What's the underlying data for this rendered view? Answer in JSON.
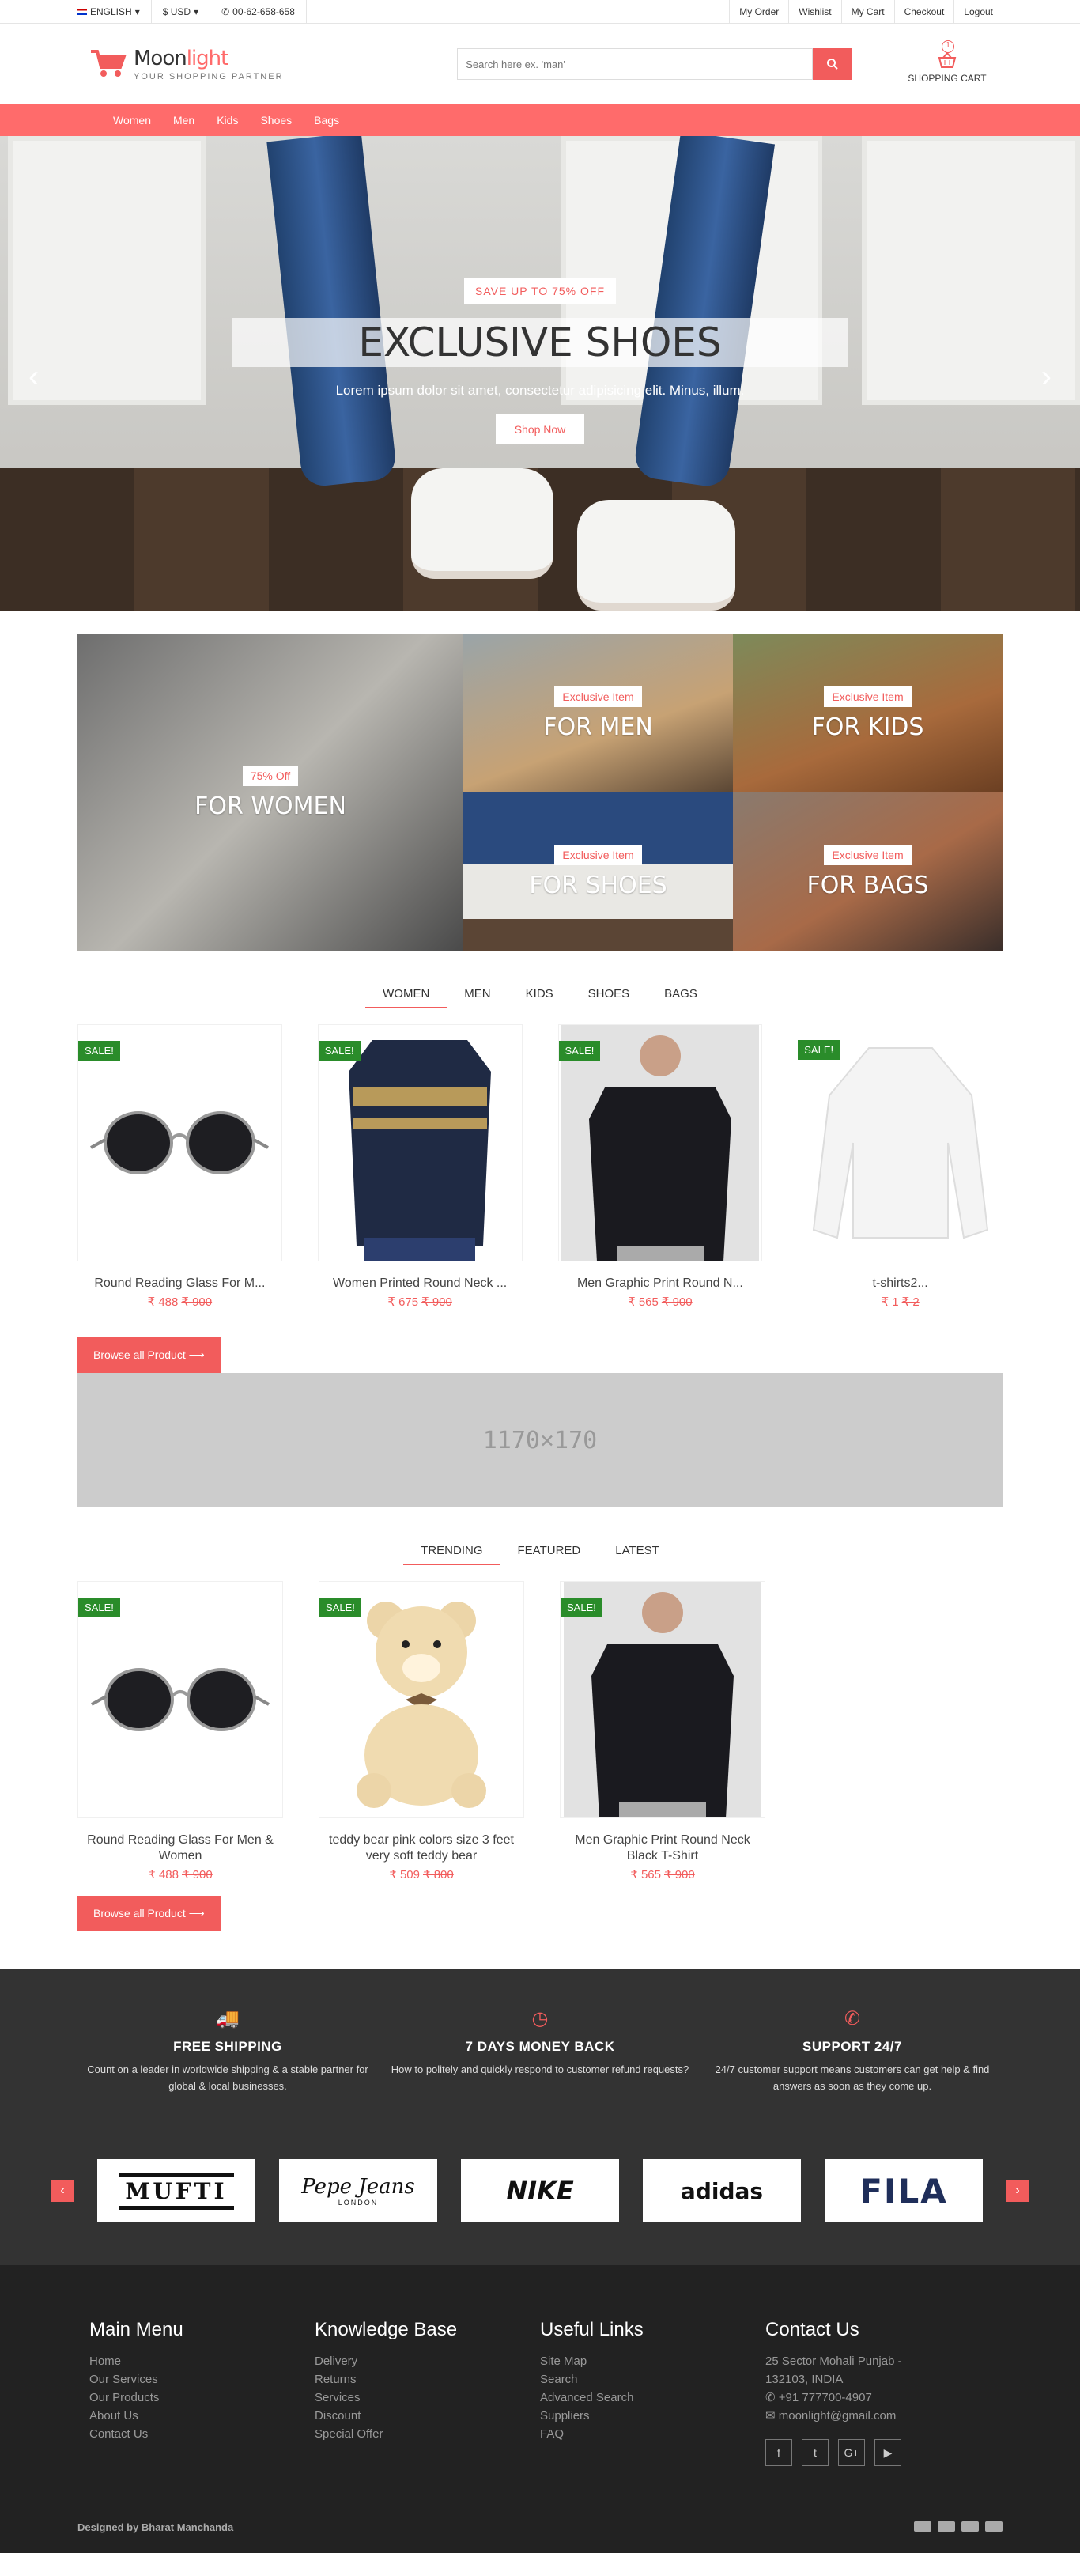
{
  "topbar": {
    "language": "ENGLISH",
    "currency": "$ USD",
    "phone": "00-62-658-658",
    "links": [
      "My Order",
      "Wishlist",
      "My Cart",
      "Checkout",
      "Logout"
    ]
  },
  "header": {
    "logo_main": "Moon",
    "logo_accent": "light",
    "tagline": "YOUR SHOPPING PARTNER",
    "search_placeholder": "Search here ex. 'man'",
    "cart_count": "1",
    "cart_label": "SHOPPING CART"
  },
  "nav": [
    "Women",
    "Men",
    "Kids",
    "Shoes",
    "Bags"
  ],
  "hero": {
    "badge": "SAVE UP TO 75% OFF",
    "title": "EXCLUSIVE SHOES",
    "subtitle": "Lorem ipsum dolor sit amet, consectetur adipisicing elit. Minus, illum.",
    "button": "Shop Now"
  },
  "categories": [
    {
      "badge": "75% Off",
      "label": "FOR WOMEN"
    },
    {
      "badge": "Exclusive Item",
      "label": "FOR MEN"
    },
    {
      "badge": "Exclusive Item",
      "label": "FOR KIDS"
    },
    {
      "badge": "Exclusive Item",
      "label": "FOR SHOES"
    },
    {
      "badge": "Exclusive Item",
      "label": "FOR BAGS"
    }
  ],
  "tabs1": [
    "WOMEN",
    "MEN",
    "KIDS",
    "SHOES",
    "BAGS"
  ],
  "products1": [
    {
      "sale": "SALE!",
      "name": "Round Reading Glass For M...",
      "price": "₹ 488",
      "old": "₹ 900"
    },
    {
      "sale": "SALE!",
      "name": "Women Printed Round Neck ...",
      "price": "₹ 675",
      "old": "₹ 900"
    },
    {
      "sale": "SALE!",
      "name": "Men Graphic Print Round N...",
      "price": "₹ 565",
      "old": "₹ 900"
    },
    {
      "sale": "SALE!",
      "name": "t-shirts2...",
      "price": "₹ 1",
      "old": "₹ 2"
    }
  ],
  "browse": "Browse all Product",
  "banner": "1170×170",
  "tabs2": [
    "TRENDING",
    "FEATURED",
    "LATEST"
  ],
  "products2": [
    {
      "sale": "SALE!",
      "name": "Round Reading Glass For Men & Women",
      "price": "₹ 488",
      "old": "₹ 900"
    },
    {
      "sale": "SALE!",
      "name": "teddy bear pink colors size 3 feet very soft teddy bear",
      "price": "₹ 509",
      "old": "₹ 800"
    },
    {
      "sale": "SALE!",
      "name": "Men Graphic Print Round Neck Black T-Shirt",
      "price": "₹ 565",
      "old": "₹ 900"
    }
  ],
  "features": [
    {
      "icon": "truck-icon",
      "title": "FREE SHIPPING",
      "text": "Count on a leader in worldwide shipping & a stable partner for global & local businesses."
    },
    {
      "icon": "clock-icon",
      "title": "7 DAYS MONEY BACK",
      "text": "How to politely and quickly respond to customer refund requests?"
    },
    {
      "icon": "phone-icon",
      "title": "SUPPORT 24/7",
      "text": "24/7 customer support means customers can get help & find answers as soon as they come up."
    }
  ],
  "brands": [
    "MUFTI",
    "Pepe Jeans",
    "NIKE",
    "adidas",
    "FILA"
  ],
  "brand_sub": "LONDON",
  "footer": {
    "main_menu": {
      "title": "Main Menu",
      "items": [
        "Home",
        "Our Services",
        "Our Products",
        "About Us",
        "Contact Us"
      ]
    },
    "knowledge": {
      "title": "Knowledge Base",
      "items": [
        "Delivery",
        "Returns",
        "Services",
        "Discount",
        "Special Offer"
      ]
    },
    "useful": {
      "title": "Useful Links",
      "items": [
        "Site Map",
        "Search",
        "Advanced Search",
        "Suppliers",
        "FAQ"
      ]
    },
    "contact": {
      "title": "Contact Us",
      "address": "25 Sector Mohali Punjab - 132103, INDIA",
      "phone": "+91 777700-4907",
      "email": "moonlight@gmail.com"
    },
    "credit": "Designed by Bharat Manchanda"
  },
  "colors": {
    "accent": "#f25c5c",
    "nav": "#ff6b6b",
    "sale": "#2a8c2a"
  }
}
